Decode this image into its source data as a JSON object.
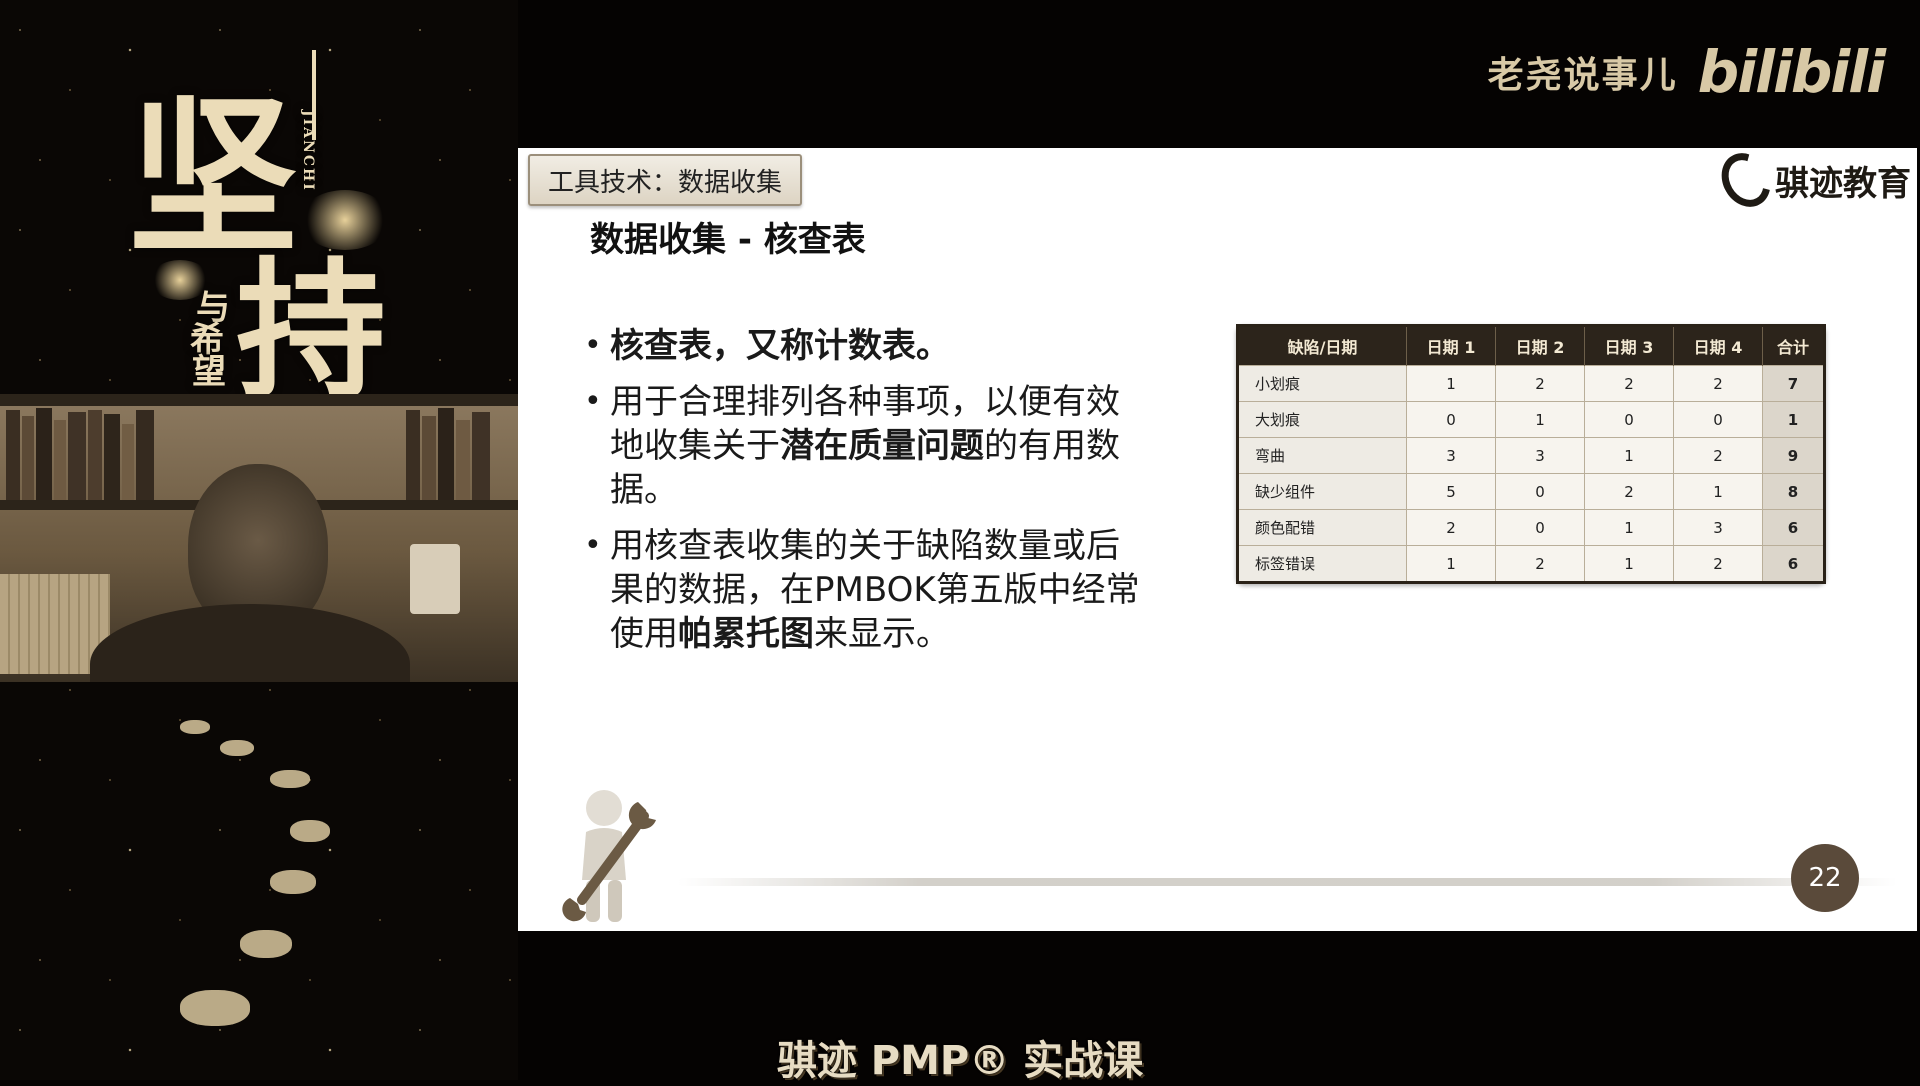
{
  "overlay": {
    "uploader": "老尧说事儿",
    "platform_logo": "bilibili",
    "banner": "骐迹 PMP® 实战课"
  },
  "poster": {
    "big_char_1": "坚",
    "big_char_2": "持",
    "pinyin": "JIANCHI",
    "subtitle_1": "与",
    "subtitle_2": "希",
    "subtitle_3": "望"
  },
  "slide": {
    "tool_tab": "工具技术：数据收集",
    "logo_text": "骐迹教育",
    "title": "数据收集 - 核查表",
    "bullets": [
      {
        "segments": [
          {
            "text": "核查表，又称计数表。",
            "bold": true
          }
        ]
      },
      {
        "segments": [
          {
            "text": "用于合理排列各种事项，以便有效地收集关于",
            "bold": false
          },
          {
            "text": "潜在质量问题",
            "bold": true
          },
          {
            "text": "的有用数据。",
            "bold": false
          }
        ]
      },
      {
        "segments": [
          {
            "text": "用核查表收集的关于缺陷数量或后果的数据，在PMBOK第五版中经常使用",
            "bold": false
          },
          {
            "text": "帕累托图",
            "bold": true
          },
          {
            "text": "来显示。",
            "bold": false
          }
        ]
      }
    ],
    "table": {
      "headers": [
        "缺陷/日期",
        "日期 1",
        "日期 2",
        "日期 3",
        "日期 4",
        "合计"
      ],
      "rows": [
        [
          "小划痕",
          "1",
          "2",
          "2",
          "2",
          "7"
        ],
        [
          "大划痕",
          "0",
          "1",
          "0",
          "0",
          "1"
        ],
        [
          "弯曲",
          "3",
          "3",
          "1",
          "2",
          "9"
        ],
        [
          "缺少组件",
          "5",
          "0",
          "2",
          "1",
          "8"
        ],
        [
          "颜色配错",
          "2",
          "0",
          "1",
          "3",
          "6"
        ],
        [
          "标签错误",
          "1",
          "2",
          "1",
          "2",
          "6"
        ]
      ]
    },
    "page_number": "22"
  }
}
